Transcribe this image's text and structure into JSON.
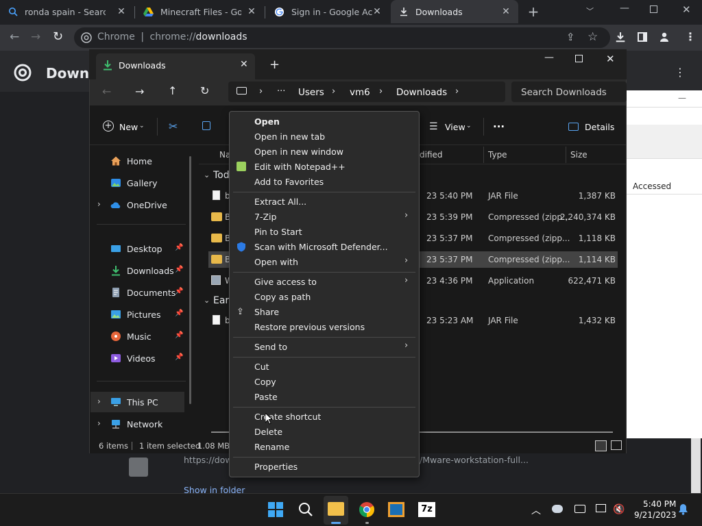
{
  "browser": {
    "tabs": [
      {
        "label": "ronda spain - Search",
        "icon": "search-icon"
      },
      {
        "label": "Minecraft Files - Googl",
        "icon": "google-drive-icon"
      },
      {
        "label": "Sign in - Google Accou",
        "icon": "google-icon"
      },
      {
        "label": "Downloads",
        "icon": "download-icon"
      }
    ],
    "omnibox": {
      "site": "Chrome",
      "separator": "|",
      "url_prefix": "chrome://",
      "url_path": "downloads"
    },
    "page_title": "Downlo",
    "bg_link_text": "https://dow",
    "bg_link_text2": "/Mware-workstation-full...",
    "show_in_folder": "Show in folder",
    "right_panel_col": "Accessed"
  },
  "explorer": {
    "tab_title": "Downloads",
    "breadcrumb": [
      "Users",
      "vm6",
      "Downloads"
    ],
    "breadcrumb_more": "···",
    "search_placeholder": "Search Downloads",
    "cmd": {
      "new": "New",
      "view": "View",
      "details": "Details",
      "more": "···"
    },
    "nav": {
      "home": "Home",
      "gallery": "Gallery",
      "onedrive": "OneDrive",
      "desktop": "Desktop",
      "downloads": "Downloads",
      "documents": "Documents",
      "pictures": "Pictures",
      "music": "Music",
      "videos": "Videos",
      "thispc": "This PC",
      "network": "Network"
    },
    "columns": {
      "name": "Na",
      "modified": "dified",
      "type": "Type",
      "size": "Size"
    },
    "groups": {
      "today": "Tod",
      "earlier": "Earl"
    },
    "rows": [
      {
        "name": "b",
        "modified": "23 5:40 PM",
        "type": "JAR File",
        "size": "1,387 KB"
      },
      {
        "name": "B",
        "modified": "23 5:39 PM",
        "type": "Compressed (zipp...",
        "size": "2,240,374 KB"
      },
      {
        "name": "B",
        "modified": "23 5:37 PM",
        "type": "Compressed (zipp...",
        "size": "1,118 KB"
      },
      {
        "name": "B",
        "modified": "23 5:37 PM",
        "type": "Compressed (zipp...",
        "size": "1,114 KB"
      },
      {
        "name": "W",
        "modified": "23 4:36 PM",
        "type": "Application",
        "size": "622,471 KB"
      },
      {
        "name": "b",
        "modified": "23 5:23 AM",
        "type": "JAR File",
        "size": "1,432 KB"
      }
    ],
    "status": {
      "count": "6 items",
      "selected": "1 item selected",
      "size": "1.08 MB"
    }
  },
  "context_menu": {
    "items": [
      "Open",
      "Open in new tab",
      "Open in new window",
      "Edit with Notepad++",
      "Add to Favorites",
      "Extract All...",
      "7-Zip",
      "Pin to Start",
      "Scan with Microsoft Defender...",
      "Open with",
      "Give access to",
      "Copy as path",
      "Share",
      "Restore previous versions",
      "Send to",
      "Cut",
      "Copy",
      "Paste",
      "Create shortcut",
      "Delete",
      "Rename",
      "Properties"
    ]
  },
  "taskbar": {
    "time": "5:40 PM",
    "date": "9/21/2023"
  },
  "colors": {
    "accent": "#0078d4",
    "selected_row": "#444444",
    "menu_bg": "#2b2b2b"
  }
}
